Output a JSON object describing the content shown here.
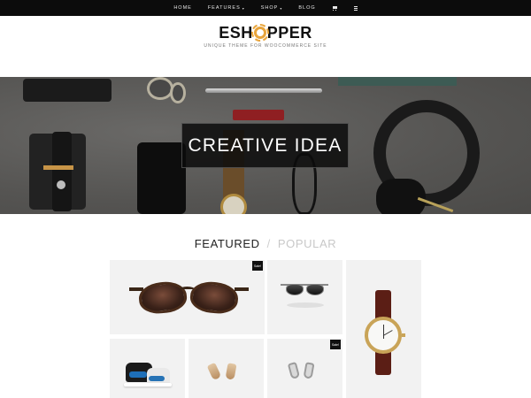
{
  "nav": {
    "items": [
      {
        "label": "HOME",
        "caret": ""
      },
      {
        "label": "FEATURES",
        "caret": "▾"
      },
      {
        "label": "SHOP",
        "caret": "▾"
      },
      {
        "label": "BLOG",
        "caret": ""
      }
    ],
    "icons": [
      "cart-icon",
      "menu-icon"
    ]
  },
  "header": {
    "logo_pre": "ESH",
    "logo_post": "PPER",
    "logo_icon": "gear-icon",
    "tagline": "UNIQUE THEME FOR WOOCOMMERCE SITE"
  },
  "hero": {
    "title": "CREATIVE IDEA"
  },
  "tabs": {
    "featured": "FEATURED",
    "separator": "/",
    "popular": "POPULAR"
  },
  "products": [
    {
      "name": "sunglasses-brown",
      "badge": "Sale!"
    },
    {
      "name": "sunglasses-sport",
      "badge": ""
    },
    {
      "name": "wrist-watch",
      "badge": ""
    },
    {
      "name": "sneakers",
      "badge": ""
    },
    {
      "name": "gold-earrings",
      "badge": ""
    },
    {
      "name": "silver-earrings",
      "badge": "Sale!"
    }
  ],
  "colors": {
    "topbar": "#0c0c0c",
    "logo_accent": "#e8a43b",
    "tile_bg": "#f2f2f2",
    "badge_bg": "#111111"
  }
}
